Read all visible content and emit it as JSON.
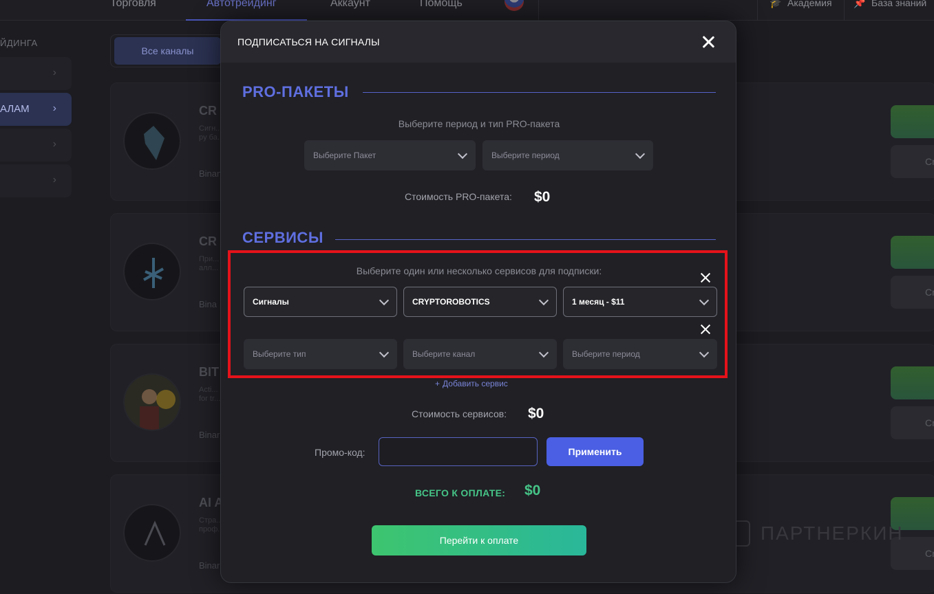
{
  "background": {
    "nav": {
      "items": [
        "Торговля",
        "Автотрейдинг",
        "Аккаунт",
        "Помощь"
      ],
      "active_index": 1,
      "academy": "Академия",
      "knowledge_base": "База знаний"
    },
    "sidebar": {
      "title": "ЙДИНГА",
      "active_label": "АЛАМ"
    },
    "filter": {
      "all_channels": "Все каналы"
    },
    "cards": [
      {
        "name": "CR",
        "desc": "Сигн... py ба...",
        "exchange": "Binan",
        "button": "Cr"
      },
      {
        "name": "CR",
        "desc": "При... алл...",
        "exchange": "Bina",
        "button": "Cr"
      },
      {
        "name": "BIT",
        "desc": "Acti... for tr...",
        "exchange": "Binar",
        "button": "Cr"
      },
      {
        "name": "AI A",
        "desc": "Cтра... проф...",
        "exchange": "Binar",
        "button": "Cr"
      }
    ],
    "watermark": "ПАРТНЕРКИН"
  },
  "modal": {
    "title": "ПОДПИСАТЬСЯ НА СИГНАЛЫ",
    "pro": {
      "heading": "PRO-ПАКЕТЫ",
      "hint": "Выберите период и тип PRO-пакета",
      "package_placeholder": "Выберите Пакет",
      "period_placeholder": "Выберите период",
      "cost_label": "Стоимость PRO-пакета:",
      "cost_value": "$0"
    },
    "services": {
      "heading": "СЕРВИСЫ",
      "hint": "Выберите один или несколько сервисов для подписки:",
      "rows": [
        {
          "type": "Сигналы",
          "channel": "CRYPTOROBOTICS",
          "period": "1 месяц - $11",
          "filled": true
        },
        {
          "type": "Выберите тип",
          "channel": "Выберите канал",
          "period": "Выберите период",
          "filled": false
        }
      ],
      "add_label": "Добавить сервис",
      "cost_label": "Стоимость сервисов:",
      "cost_value": "$0"
    },
    "promo": {
      "label": "Промо-код:",
      "value": "",
      "apply_label": "Применить"
    },
    "total": {
      "label": "ВСЕГО К ОПЛАТЕ:",
      "value": "$0"
    },
    "pay_label": "Перейти к оплате"
  }
}
